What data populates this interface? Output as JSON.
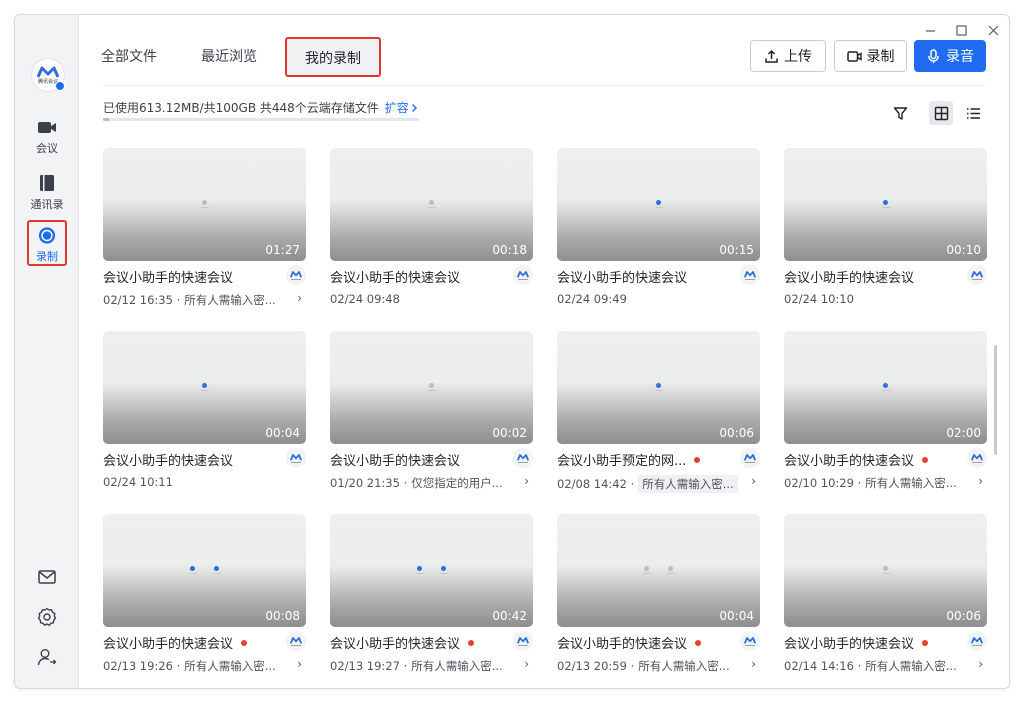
{
  "window": {
    "title": "腾讯会议"
  },
  "logo": {
    "text": "腾讯会议"
  },
  "sidebar": {
    "items": [
      {
        "label": "会议",
        "icon": "camera-icon"
      },
      {
        "label": "通讯录",
        "icon": "contacts-icon"
      },
      {
        "label": "录制",
        "icon": "record-icon"
      }
    ],
    "bottom": [
      {
        "icon": "mail-icon"
      },
      {
        "icon": "gear-icon"
      },
      {
        "icon": "user-switch-icon"
      }
    ]
  },
  "tabs": [
    {
      "label": "全部文件",
      "active": false
    },
    {
      "label": "最近浏览",
      "active": false
    },
    {
      "label": "我的录制",
      "active": true
    }
  ],
  "actions": {
    "upload": "上传",
    "record": "录制",
    "audio": "录音"
  },
  "storage": {
    "text": "已使用613.12MB/共100GB  共448个云端存储文件",
    "expand": "扩容",
    "used_fraction": 0.006
  },
  "colors": {
    "accent": "#1f6cf0",
    "highlight_border": "#e2362d",
    "rec_dot": "#e6412f"
  },
  "cards": [
    {
      "title": "会议小助手的快速会议",
      "time": "02/12 16:35",
      "perm": "所有人需输入密...",
      "duration": "01:27",
      "rec": false,
      "arrow": true
    },
    {
      "title": "会议小助手的快速会议",
      "time": "02/24 09:48",
      "perm": "",
      "duration": "00:18",
      "rec": false,
      "arrow": false
    },
    {
      "title": "会议小助手的快速会议",
      "time": "02/24 09:49",
      "perm": "",
      "duration": "00:15",
      "rec": false,
      "arrow": false
    },
    {
      "title": "会议小助手的快速会议",
      "time": "02/24 10:10",
      "perm": "",
      "duration": "00:10",
      "rec": false,
      "arrow": false
    },
    {
      "title": "会议小助手的快速会议",
      "time": "02/24 10:11",
      "perm": "",
      "duration": "00:04",
      "rec": false,
      "arrow": false
    },
    {
      "title": "会议小助手的快速会议",
      "time": "01/20 21:35",
      "perm": "仅您指定的用户...",
      "duration": "00:02",
      "rec": false,
      "arrow": true
    },
    {
      "title": "会议小助手预定的网...",
      "time": "02/08 14:42",
      "perm": "所有人需输入密...",
      "duration": "00:06",
      "rec": true,
      "arrow": true
    },
    {
      "title": "会议小助手的快速会议",
      "time": "02/10 10:29",
      "perm": "所有人需输入密...",
      "duration": "02:00",
      "rec": true,
      "arrow": true
    },
    {
      "title": "会议小助手的快速会议",
      "time": "02/13 19:26",
      "perm": "所有人需输入密...",
      "duration": "00:08",
      "rec": true,
      "arrow": true
    },
    {
      "title": "会议小助手的快速会议",
      "time": "02/13 19:27",
      "perm": "所有人需输入密...",
      "duration": "00:42",
      "rec": true,
      "arrow": true
    },
    {
      "title": "会议小助手的快速会议",
      "time": "02/13 20:59",
      "perm": "所有人需输入密...",
      "duration": "00:04",
      "rec": true,
      "arrow": true
    },
    {
      "title": "会议小助手的快速会议",
      "time": "02/14 14:16",
      "perm": "所有人需输入密...",
      "duration": "00:06",
      "rec": true,
      "arrow": true
    }
  ]
}
